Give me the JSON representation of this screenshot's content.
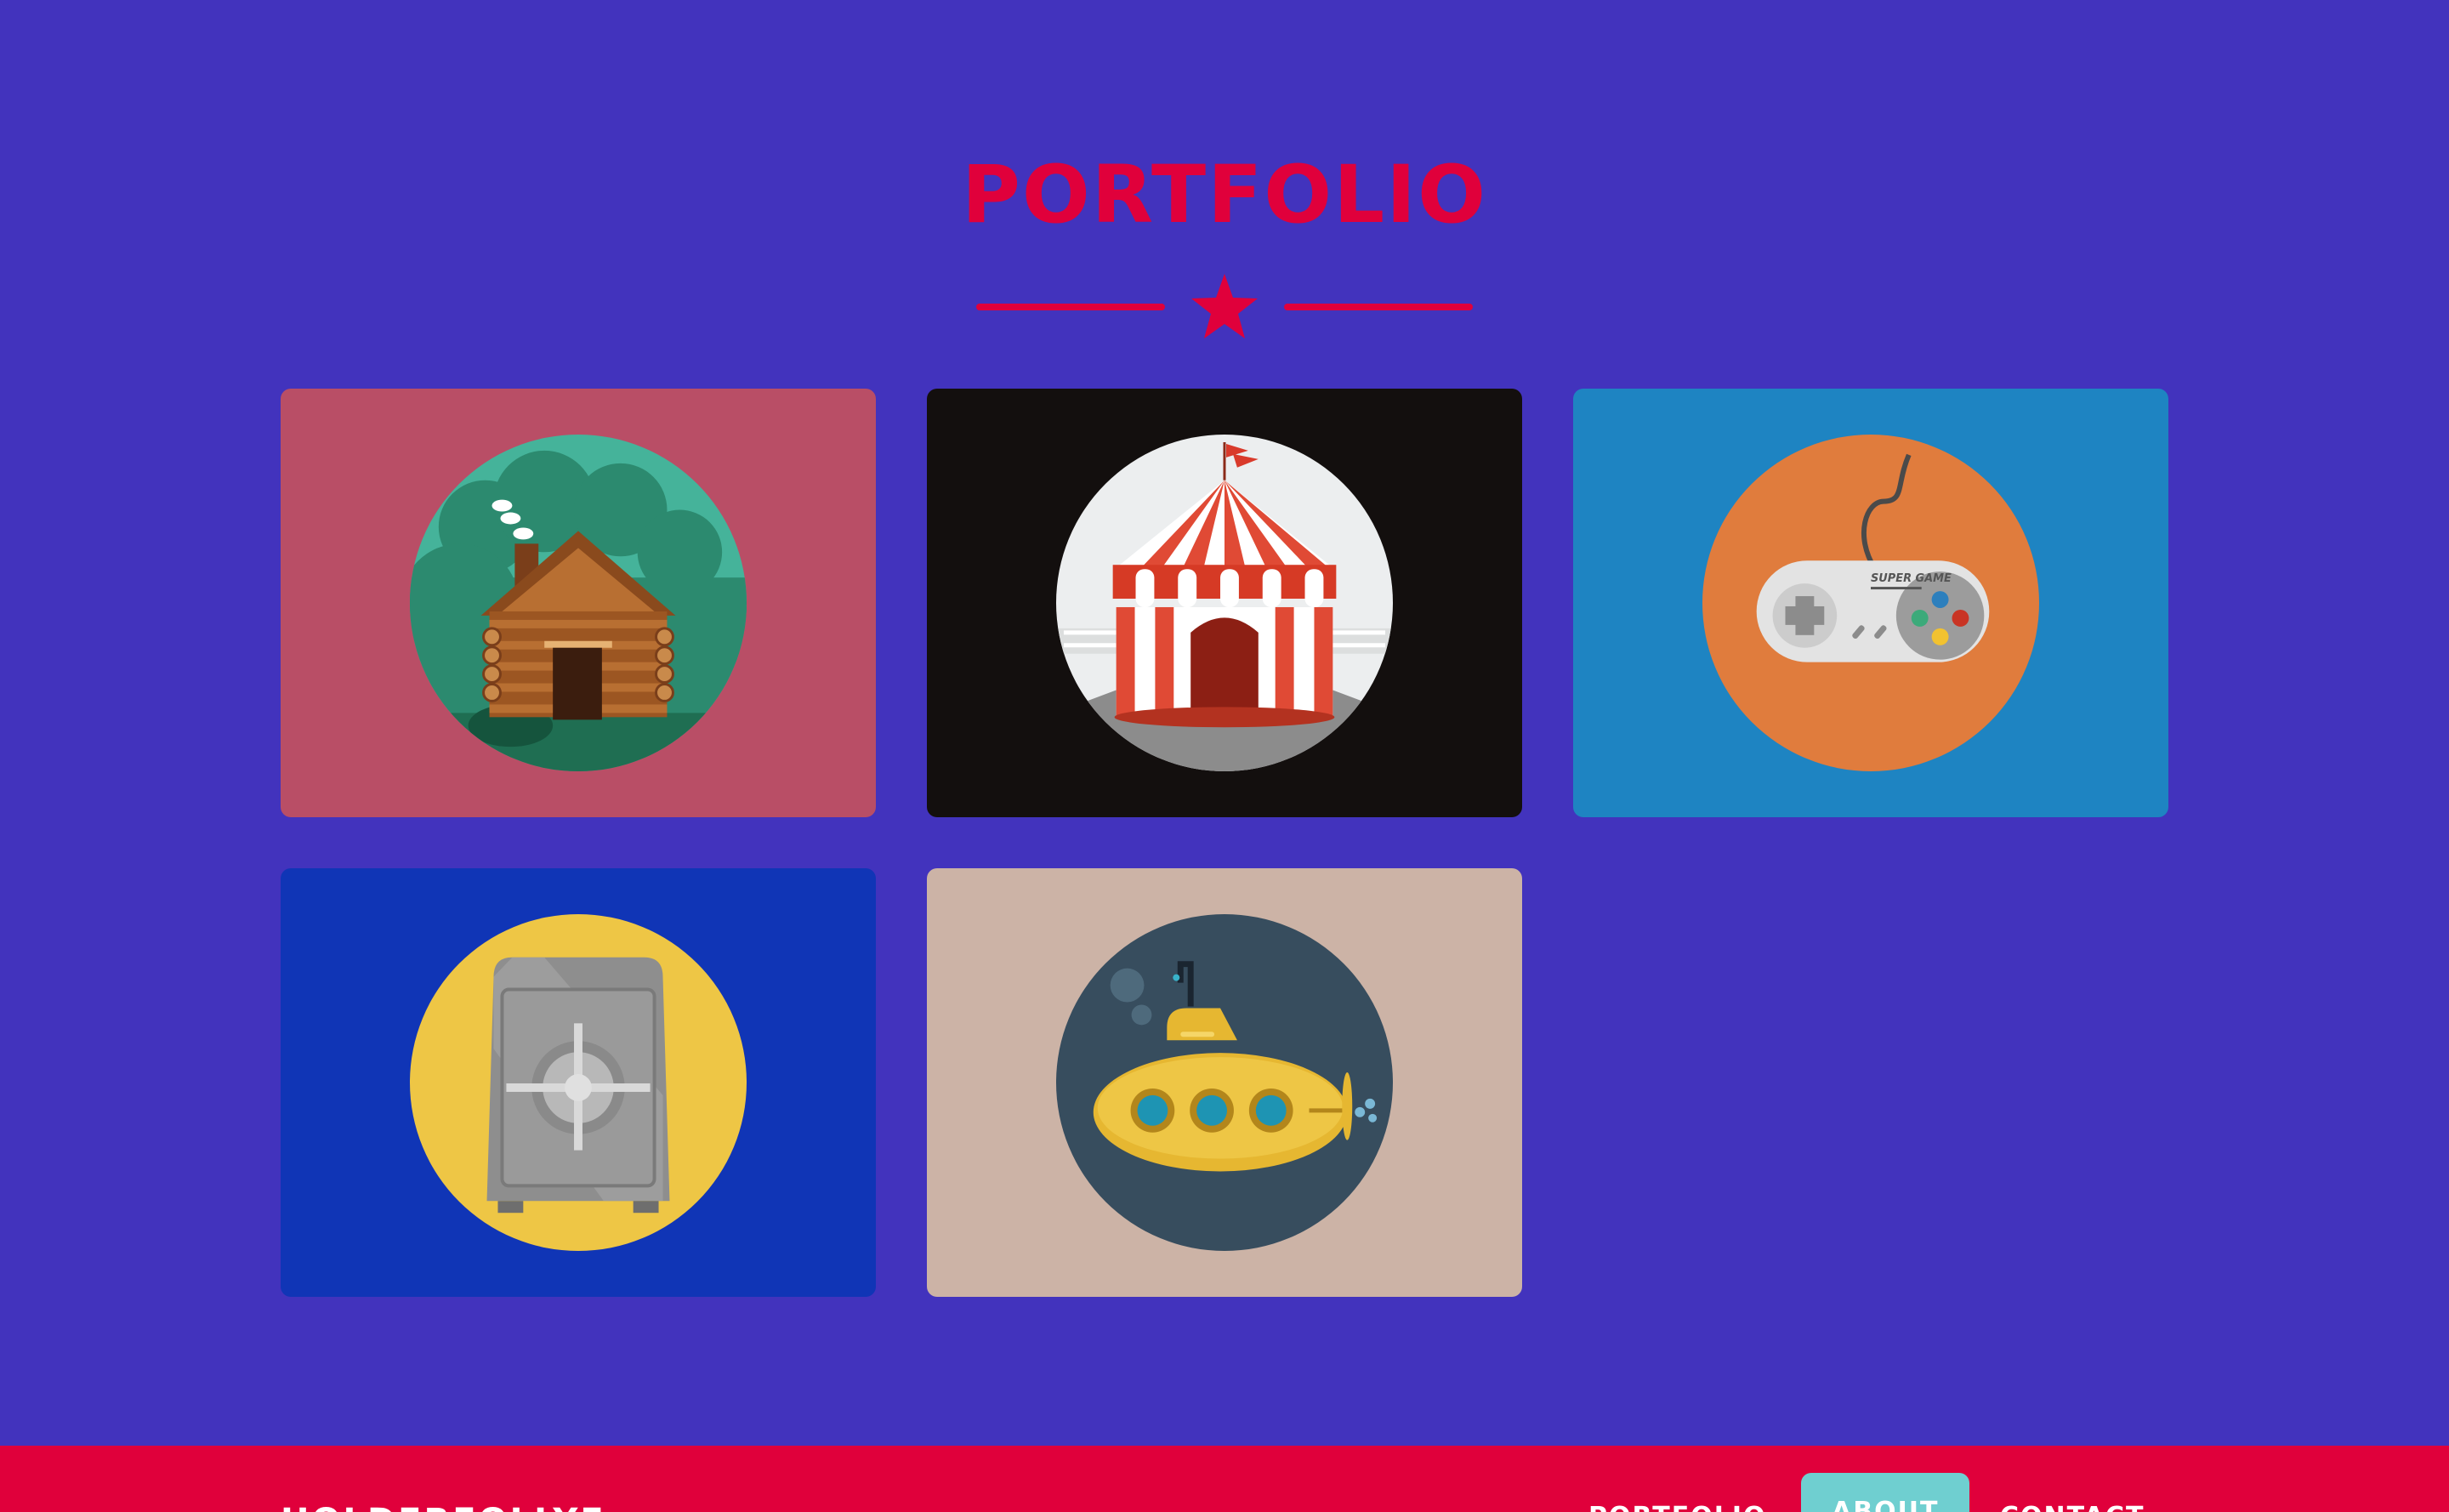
{
  "section": {
    "title": "PORTFOLIO"
  },
  "portfolio": {
    "items": [
      {
        "name": "cabin",
        "card_color": "#b94e66",
        "circle_color": "#3a9f86",
        "icon": "log-cabin-icon"
      },
      {
        "name": "circus",
        "card_color": "#130f0e",
        "circle_color": "#eceeef",
        "icon": "circus-tent-icon"
      },
      {
        "name": "game",
        "card_color": "#1e84c2",
        "circle_color": "#e07c3d",
        "icon": "game-controller-icon"
      },
      {
        "name": "safe",
        "card_color": "#1035b6",
        "circle_color": "#eec645",
        "icon": "safe-icon"
      },
      {
        "name": "submarine",
        "card_color": "#ccb3a6",
        "circle_color": "#374d5e",
        "icon": "submarine-icon"
      }
    ]
  },
  "colors": {
    "background": "#4233bd",
    "accent": "#e0003b",
    "active_nav": "#6fcfd0"
  },
  "controller_label": "SUPER GAME",
  "navbar": {
    "brand": "HOLDERFOLLYE",
    "links": [
      "PORTFOLIO",
      "ABOUT",
      "CONTACT"
    ],
    "active": "ABOUT"
  }
}
